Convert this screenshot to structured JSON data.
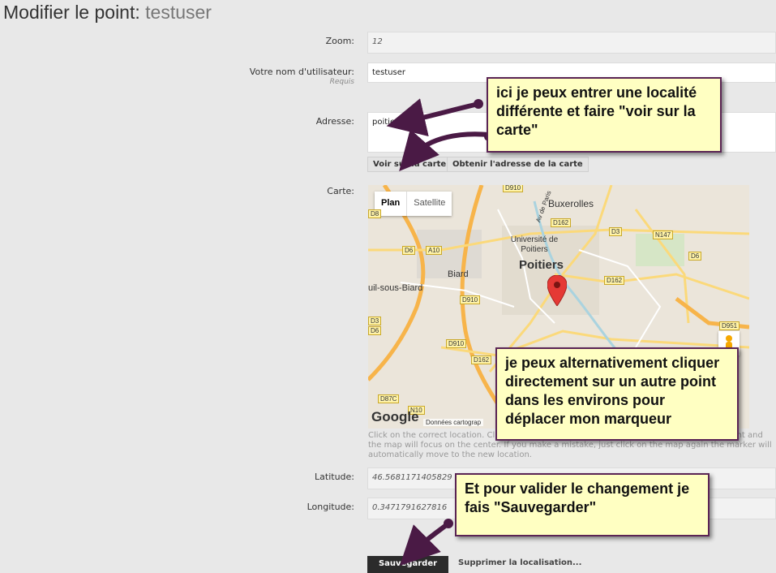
{
  "header": {
    "title_prefix": "Modifier le point:",
    "title_user": "testuser"
  },
  "form": {
    "zoom": {
      "label": "Zoom:",
      "value": "12"
    },
    "username": {
      "label": "Votre nom d'utilisateur:",
      "required": "Requis",
      "value": "testuser"
    },
    "address": {
      "label": "Adresse:",
      "value": "poitier"
    },
    "buttons": {
      "show_on_map": "Voir sur la carte",
      "get_address": "Obtenir l'adresse de la carte"
    },
    "map": {
      "label": "Carte:"
    },
    "help_text": "Click on the correct location. Click the map again and the marker will be moved to that point and the map will focus on the center. If you make a mistake, just click on the map again the marker will automatically move to the new location.",
    "latitude": {
      "label": "Latitude:",
      "value": "46.5681171405829"
    },
    "longitude": {
      "label": "Longitude:",
      "value": "0.3471791627816"
    },
    "save": "Sauvegarder",
    "delete_location": "Supprimer la localisation..."
  },
  "map": {
    "tabs": [
      "Plan",
      "Satellite"
    ],
    "places": {
      "city": "Poitiers",
      "university": "Université de Poitiers",
      "buxerolles": "Buxerolles",
      "biard": "Biard",
      "biard_area": "uil-sous-Biard",
      "avenue": "Av de Paris"
    },
    "roads": [
      "D910",
      "D8",
      "D6",
      "A10",
      "D162",
      "D3",
      "N147",
      "D6",
      "D910",
      "D162",
      "D910",
      "D162",
      "D951",
      "D87C",
      "N10",
      "D3",
      "D6"
    ],
    "attribution": "Données cartograp",
    "logo": "Google",
    "colors": {
      "water": "#aad3df",
      "major_road": "#f7b44a",
      "minor_road": "#ffffff",
      "marker": "#e53935"
    }
  },
  "annotations": {
    "address_note": "ici je peux entrer une localité différente et faire \"voir sur la carte\"",
    "map_note": "je peux alternativement cliquer directement sur un autre point dans les environs pour déplacer mon marqueur",
    "save_note": "Et pour valider le changement je fais \"Sauvegarder\""
  },
  "colors": {
    "note_bg": "#ffffc2",
    "note_border": "#5a2454",
    "arrow": "#4a1a45"
  }
}
